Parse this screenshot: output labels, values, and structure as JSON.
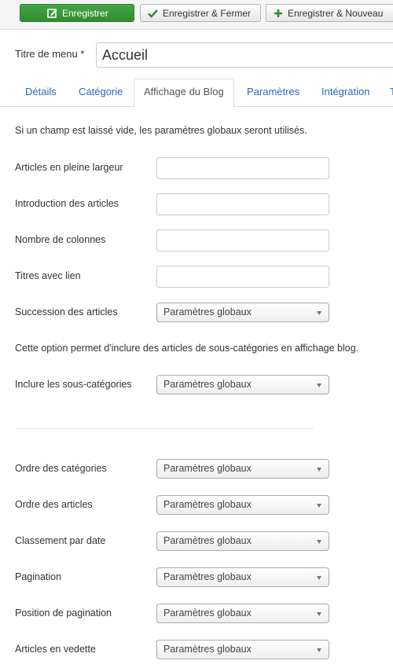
{
  "toolbar": {
    "save_label": "Enregistrer",
    "save_close_label": "Enregistrer & Fermer",
    "save_new_label": "Enregistrer & Nouveau"
  },
  "menu_title": {
    "label": "Titre de menu *",
    "value": "Accueil"
  },
  "tabs": [
    {
      "label": "Détails",
      "active": false
    },
    {
      "label": "Catégorie",
      "active": false
    },
    {
      "label": "Affichage du Blog",
      "active": true
    },
    {
      "label": "Paramètres",
      "active": false
    },
    {
      "label": "Intégration",
      "active": false
    }
  ],
  "notes": {
    "global_hint": "Si un champ est laissé vide, les paramètres globaux seront utilisés.",
    "subcategory_hint": "Cette option permet d'inclure des articles de sous-catégories en affichage blog."
  },
  "fields": {
    "leading_articles": {
      "label": "Articles en pleine largeur",
      "value": ""
    },
    "intro_articles": {
      "label": "Introduction des articles",
      "value": ""
    },
    "columns": {
      "label": "Nombre de colonnes",
      "value": ""
    },
    "links": {
      "label": "Titres avec lien",
      "value": ""
    },
    "multi_column_order": {
      "label": "Succession des articles",
      "value": "Paramètres globaux"
    },
    "show_subcategory_content": {
      "label": "Inclure les sous-catégories",
      "value": "Paramètres globaux"
    },
    "category_order": {
      "label": "Ordre des catégories",
      "value": "Paramètres globaux"
    },
    "article_order": {
      "label": "Ordre des articles",
      "value": "Paramètres globaux"
    },
    "date_order": {
      "label": "Classement par date",
      "value": "Paramètres globaux"
    },
    "pagination": {
      "label": "Pagination",
      "value": "Paramètres globaux"
    },
    "pagination_position": {
      "label": "Position de pagination",
      "value": "Paramètres globaux"
    },
    "featured_articles": {
      "label": "Articles en vedette",
      "value": "Paramètres globaux"
    }
  },
  "colors": {
    "save_green": "#46a546",
    "tab_link": "#2a69b8"
  },
  "icons": {
    "save": "edit-icon",
    "save_close": "check-icon",
    "save_new": "plus-icon"
  }
}
